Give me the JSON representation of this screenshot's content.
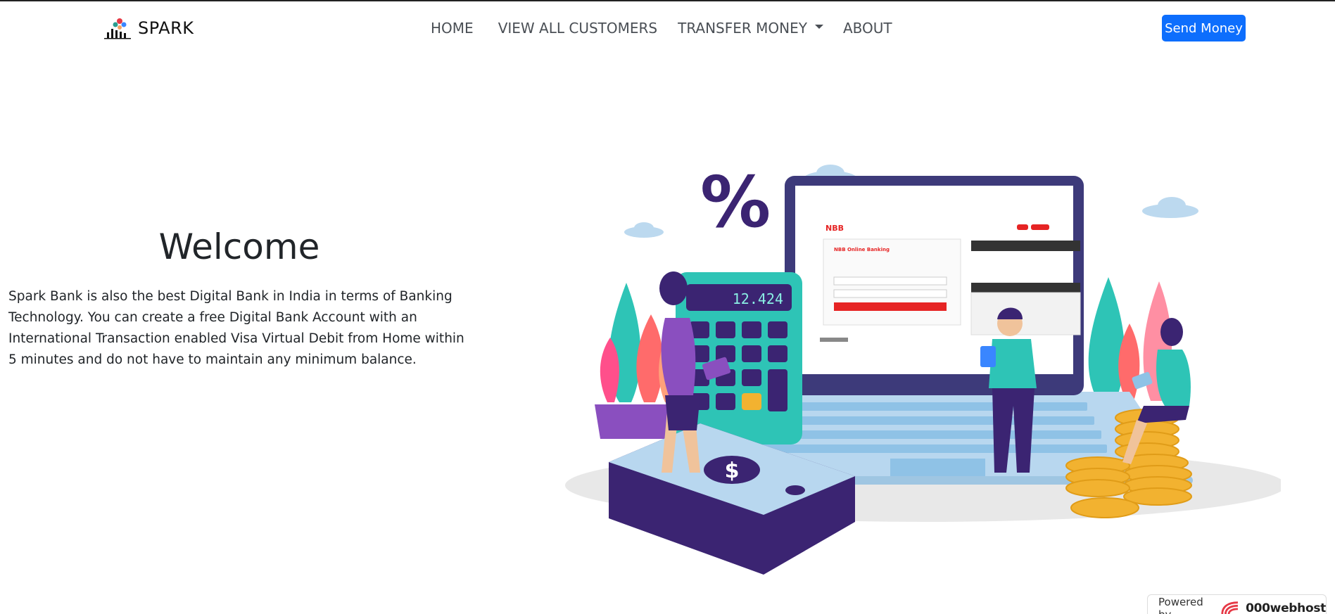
{
  "navbar": {
    "brand": "SPARK",
    "links": [
      {
        "label": "HOME"
      },
      {
        "label": "VIEW ALL CUSTOMERS"
      },
      {
        "label": "TRANSFER MONEY"
      },
      {
        "label": "ABOUT"
      }
    ],
    "cta": "Send Money"
  },
  "hero": {
    "title": "Welcome",
    "description": "Spark Bank is also the best Digital Bank in India in terms of Banking Technology. You can create a free Digital Bank Account with an International Transaction enabled Visa Virtual Debit from Home within 5 minutes and do not have to maintain any minimum balance.",
    "illustration": {
      "calculator_display": "12.424",
      "percent_sign": "%",
      "screen_bank_logo": "NBB",
      "screen_heading": "NBB Online Banking",
      "currency_symbol": "$"
    }
  },
  "footer_badge": {
    "label": "Powered by",
    "brand": "000webhost"
  },
  "colors": {
    "primary": "#0d6efd",
    "purple": "#3b2472",
    "teal": "#2ec4b6",
    "gold": "#f2b230",
    "screen_red": "#e62424"
  },
  "icons": {
    "brand": "bar-chart-people-logo",
    "dropdown": "caret-down-icon",
    "badge": "webhost-logo-icon"
  }
}
